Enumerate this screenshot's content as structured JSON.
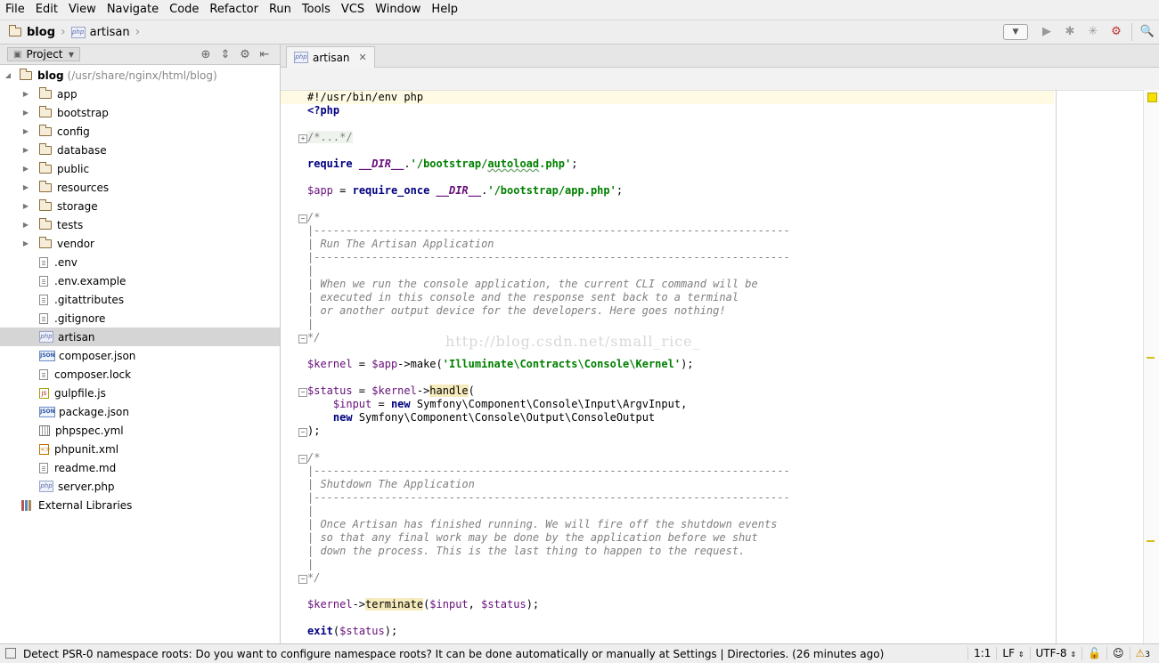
{
  "menu": [
    "File",
    "Edit",
    "View",
    "Navigate",
    "Code",
    "Refactor",
    "Run",
    "Tools",
    "VCS",
    "Window",
    "Help"
  ],
  "nav": {
    "project": "blog",
    "file": "artisan"
  },
  "project_panel": {
    "tab_label": "Project",
    "root": {
      "name": "blog",
      "path": "(/usr/share/nginx/html/blog)"
    },
    "folders": [
      "app",
      "bootstrap",
      "config",
      "database",
      "public",
      "resources",
      "storage",
      "tests",
      "vendor"
    ],
    "files": [
      {
        "name": ".env",
        "type": "text"
      },
      {
        "name": ".env.example",
        "type": "text"
      },
      {
        "name": ".gitattributes",
        "type": "text"
      },
      {
        "name": ".gitignore",
        "type": "text"
      },
      {
        "name": "artisan",
        "type": "php"
      },
      {
        "name": "composer.json",
        "type": "json"
      },
      {
        "name": "composer.lock",
        "type": "text"
      },
      {
        "name": "gulpfile.js",
        "type": "js"
      },
      {
        "name": "package.json",
        "type": "json"
      },
      {
        "name": "phpspec.yml",
        "type": "yml"
      },
      {
        "name": "phpunit.xml",
        "type": "xml"
      },
      {
        "name": "readme.md",
        "type": "text"
      },
      {
        "name": "server.php",
        "type": "php"
      }
    ],
    "external": "External Libraries",
    "selected": "artisan"
  },
  "editor": {
    "tab": "artisan",
    "watermark": "http://blog.csdn.net/small_rice_",
    "code": {
      "l1": "#!/usr/bin/env php",
      "l2": "<?php",
      "l3": "/*...*/",
      "l4_kw": "require",
      "l4_const": "__DIR__",
      "l4_str_a": "'/bootstrap/",
      "l4_str_b": "autoload",
      "l4_str_c": ".php'",
      "l5_var": "$app",
      "l5_kw": "require_once",
      "l5_const": "__DIR__",
      "l5_str": "'/bootstrap/app.php'",
      "c1_open": "/*",
      "c1_rule": "|--------------------------------------------------------------------------",
      "c1_title": "| Run The Artisan Application",
      "c1_bar": "|",
      "c1_t1": "| When we run the console application, the current CLI command will be",
      "c1_t2": "| executed in this console and the response sent back to a terminal",
      "c1_t3": "| or another output device for the developers. Here goes nothing!",
      "c1_close": "*/",
      "k1_var": "$kernel",
      "k1_var2": "$app",
      "k1_make": "->make(",
      "k1_str": "'Illuminate\\Contracts\\Console\\Kernel'",
      "k1_end": ");",
      "s_var": "$status",
      "s_var2": "$kernel",
      "s_handle": "handle",
      "i_var": "$input",
      "i_new": "new",
      "i_cls": "Symfony\\Component\\Console\\Input\\ArgvInput,",
      "o_new": "new",
      "o_cls": "Symfony\\Component\\Console\\Output\\ConsoleOutput",
      "s_close": ");",
      "c2_title": "| Shutdown The Application",
      "c2_t1": "| Once Artisan has finished running. We will fire off the shutdown events",
      "c2_t2": "| so that any final work may be done by the application before we shut",
      "c2_t3": "| down the process. This is the last thing to happen to the request.",
      "t_var": "$kernel",
      "t_fn": "terminate",
      "t_args_a": "(",
      "t_arg1": "$input",
      "t_args_b": ", ",
      "t_arg2": "$status",
      "t_args_c": ");",
      "e_kw": "exit",
      "e_var": "$status",
      "e_end": ");"
    }
  },
  "status": {
    "message": "Detect PSR-0 namespace roots: Do you want to configure namespace roots? It can be done automatically or manually at Settings | Directories. (26 minutes ago)",
    "position": "1:1",
    "line_sep": "LF",
    "encoding": "UTF-8",
    "warnings": "3"
  }
}
